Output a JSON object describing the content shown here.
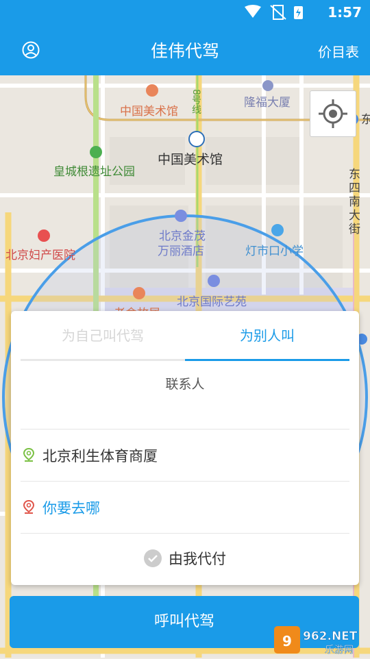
{
  "status_bar": {
    "time": "1:57"
  },
  "app_bar": {
    "title": "佳伟代驾",
    "price_list": "价目表",
    "user_icon": "user-icon"
  },
  "map": {
    "pois": {
      "art_museum_top": "中国美术馆",
      "metro_line": "8号线",
      "longfu": "隆福大厦",
      "east_partial": "东",
      "art_museum": "中国美术馆",
      "huangcheng": "皇城根遗址公园",
      "jinmao_1": "北京金茂",
      "jinmao_2": "万丽酒店",
      "dengshikou": "灯市口小学",
      "maternity": "北京妇产医院",
      "dongsi_1": "东",
      "dongsi_2": "四",
      "dongsi_3": "南",
      "dongsi_4": "大",
      "dongsi_5": "街",
      "art_garden": "北京国际艺苑",
      "laoshe": "老舍故居"
    },
    "colors": {
      "road_yellow": "#f6d77c",
      "road_green": "#a9d86e",
      "radius": "#4a9ee8"
    }
  },
  "order_card": {
    "tabs": {
      "self": "为自己叫代驾",
      "other": "为别人叫"
    },
    "contact_label": "联系人",
    "start_location": "北京利生体育商厦",
    "destination_placeholder": "你要去哪",
    "pay_label": "由我代付"
  },
  "call_button": "呼叫代驾",
  "watermark": {
    "brand": "962.NET",
    "sub": "乐游网"
  }
}
